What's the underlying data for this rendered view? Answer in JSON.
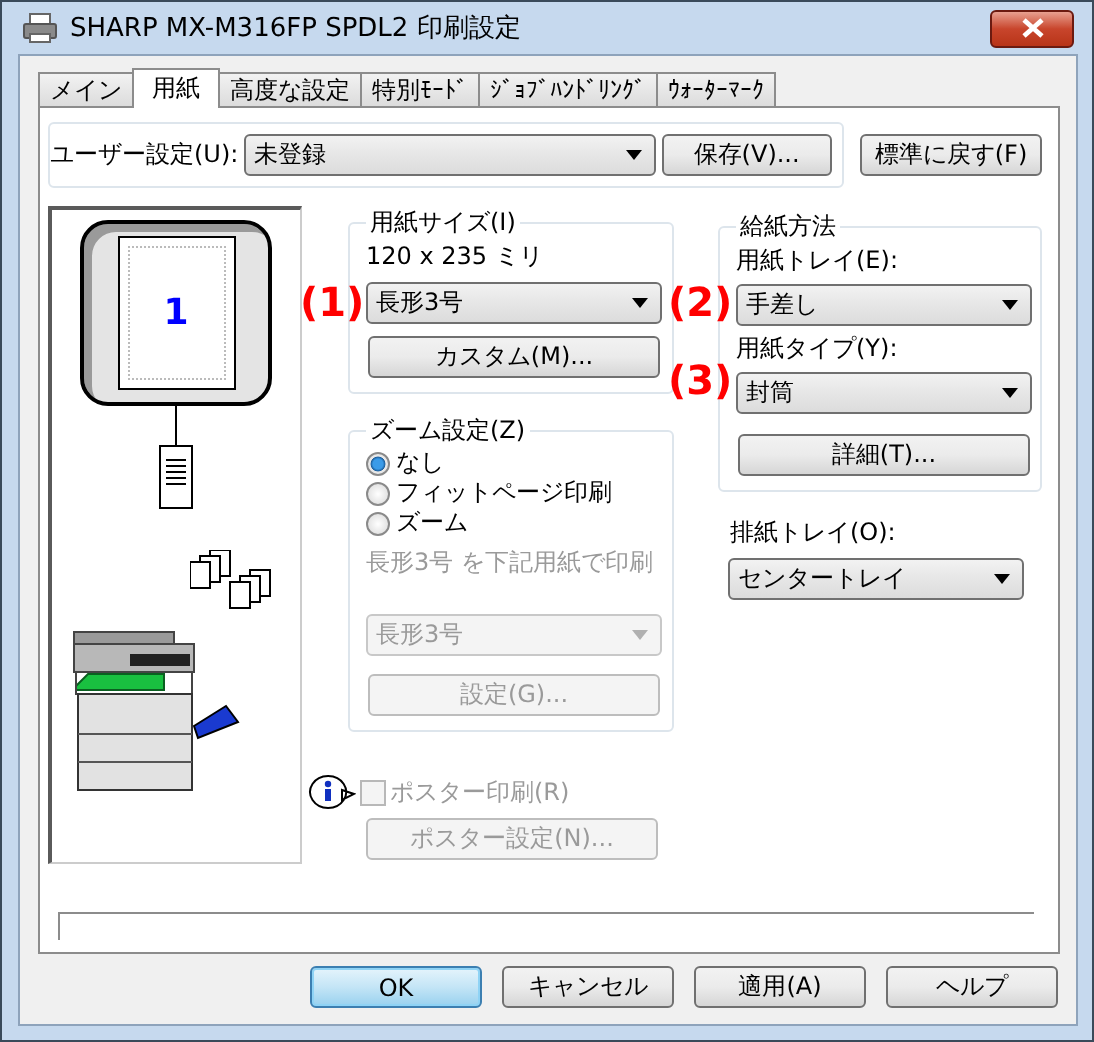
{
  "window": {
    "title": "SHARP MX-M316FP SPDL2 印刷設定"
  },
  "tabs": [
    {
      "label": "メイン",
      "selected": false
    },
    {
      "label": "用紙",
      "selected": true
    },
    {
      "label": "高度な設定",
      "selected": false
    },
    {
      "label": "特別ﾓｰﾄﾞ",
      "selected": false
    },
    {
      "label": "ｼﾞｮﾌﾞﾊﾝﾄﾞﾘﾝｸﾞ",
      "selected": false
    },
    {
      "label": "ｳｫｰﾀｰﾏｰｸ",
      "selected": false
    }
  ],
  "user_setting": {
    "label": "ユーザー設定(U):",
    "value": "未登録",
    "save_button": "保存(V)...",
    "reset_button": "標準に戻す(F)"
  },
  "preview": {
    "page_number": "1"
  },
  "paper_size": {
    "title": "用紙サイズ(I)",
    "dimensions": "120 x 235 ミリ",
    "value": "長形3号",
    "custom_button": "カスタム(M)..."
  },
  "zoom": {
    "title": "ズーム設定(Z)",
    "options": [
      {
        "label": "なし",
        "selected": true
      },
      {
        "label": "フィットページ印刷",
        "selected": false
      },
      {
        "label": "ズーム",
        "selected": false
      }
    ],
    "note": "長形3号 を下記用紙で印刷",
    "value": "長形3号",
    "disabled": true,
    "settings_button": "設定(G)..."
  },
  "paper_feed": {
    "title": "給紙方法",
    "tray_label": "用紙トレイ(E):",
    "tray": "手差し",
    "type_label": "用紙タイプ(Y):",
    "type": "封筒",
    "detail_button": "詳細(T)..."
  },
  "output_tray": {
    "label": "排紙トレイ(O):",
    "value": "センタートレイ"
  },
  "poster": {
    "label": "ポスター印刷(R)",
    "checked": false,
    "disabled": true,
    "button": "ポスター設定(N)..."
  },
  "callouts": [
    "(1)",
    "(2)",
    "(3)"
  ],
  "buttons": [
    {
      "label": "OK",
      "default": true
    },
    {
      "label": "キャンセル",
      "default": false
    },
    {
      "label": "適用(A)",
      "default": false
    },
    {
      "label": "ヘルプ",
      "default": false
    }
  ]
}
